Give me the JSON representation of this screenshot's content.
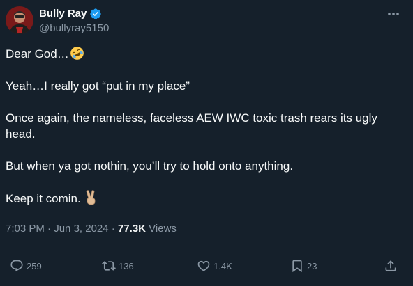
{
  "author": {
    "name": "Bully Ray",
    "handle": "@bullyray5150"
  },
  "tweet": {
    "lines": [
      "Dear God…",
      "Yeah…I really got “put in my place”",
      "Once again, the nameless, faceless AEW IWC toxic trash rears its ugly head.",
      "But when ya got nothin, you’ll try to hold onto anything.",
      "Keep it comin."
    ],
    "emojis": [
      "rolling-on-floor-laughing-emoji",
      "victory-hand-emoji"
    ]
  },
  "meta": {
    "time": "7:03 PM",
    "separator": "·",
    "date": "Jun 3, 2024",
    "views_count": "77.3K",
    "views_label": "Views"
  },
  "actions": {
    "replies": "259",
    "reposts": "136",
    "likes": "1.4K",
    "bookmarks": "23"
  },
  "colors": {
    "background": "#15202b",
    "text": "#f7f9f9",
    "secondary": "#8b98a5",
    "divider": "#38444d",
    "verified": "#1d9bf0"
  }
}
